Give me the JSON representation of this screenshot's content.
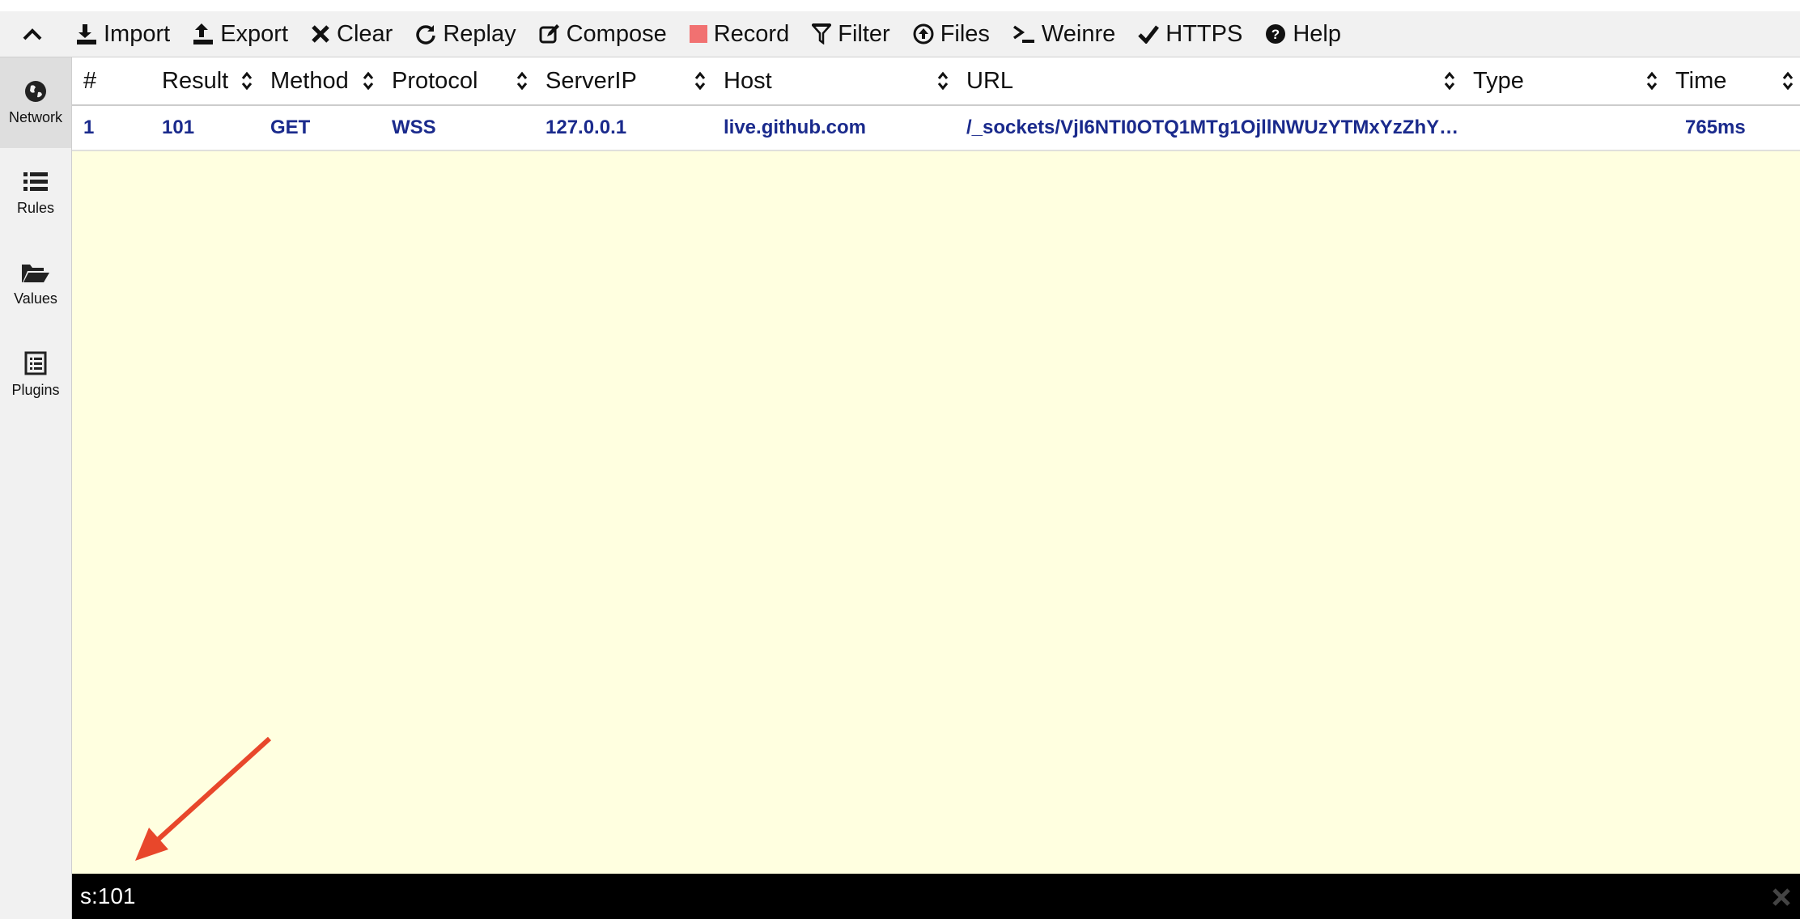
{
  "toolbar": {
    "items": [
      {
        "label": "Import",
        "icon": "import-icon"
      },
      {
        "label": "Export",
        "icon": "export-icon"
      },
      {
        "label": "Clear",
        "icon": "close-x-icon"
      },
      {
        "label": "Replay",
        "icon": "replay-icon"
      },
      {
        "label": "Compose",
        "icon": "compose-icon"
      },
      {
        "label": "Record",
        "icon": "record-icon",
        "color": "#f17171"
      },
      {
        "label": "Filter",
        "icon": "filter-icon"
      },
      {
        "label": "Files",
        "icon": "upload-circle-icon"
      },
      {
        "label": "Weinre",
        "icon": "terminal-icon"
      },
      {
        "label": "HTTPS",
        "icon": "check-icon"
      },
      {
        "label": "Help",
        "icon": "question-circle-icon"
      }
    ]
  },
  "sidebar": {
    "items": [
      {
        "label": "Network",
        "icon": "globe-icon",
        "active": true
      },
      {
        "label": "Rules",
        "icon": "list-icon"
      },
      {
        "label": "Values",
        "icon": "folder-open-icon"
      },
      {
        "label": "Plugins",
        "icon": "document-list-icon"
      }
    ]
  },
  "table": {
    "columns": [
      "#",
      "Result",
      "Method",
      "Protocol",
      "ServerIP",
      "Host",
      "URL",
      "Type",
      "Time"
    ],
    "rows": [
      {
        "num": "1",
        "result": "101",
        "method": "GET",
        "protocol": "WSS",
        "server_ip": "127.0.0.1",
        "host": "live.github.com",
        "url": "/_sockets/VjI6NTI0OTQ1MTg1OjllNWUzYTMxYzZhY…",
        "type": "",
        "time": "765ms"
      }
    ]
  },
  "filter": {
    "value": "s:101"
  },
  "colors": {
    "row_text": "#1a2a8c",
    "list_background": "#ffffe0",
    "filter_bar": "#000000",
    "annotation_arrow": "#e8472b"
  }
}
